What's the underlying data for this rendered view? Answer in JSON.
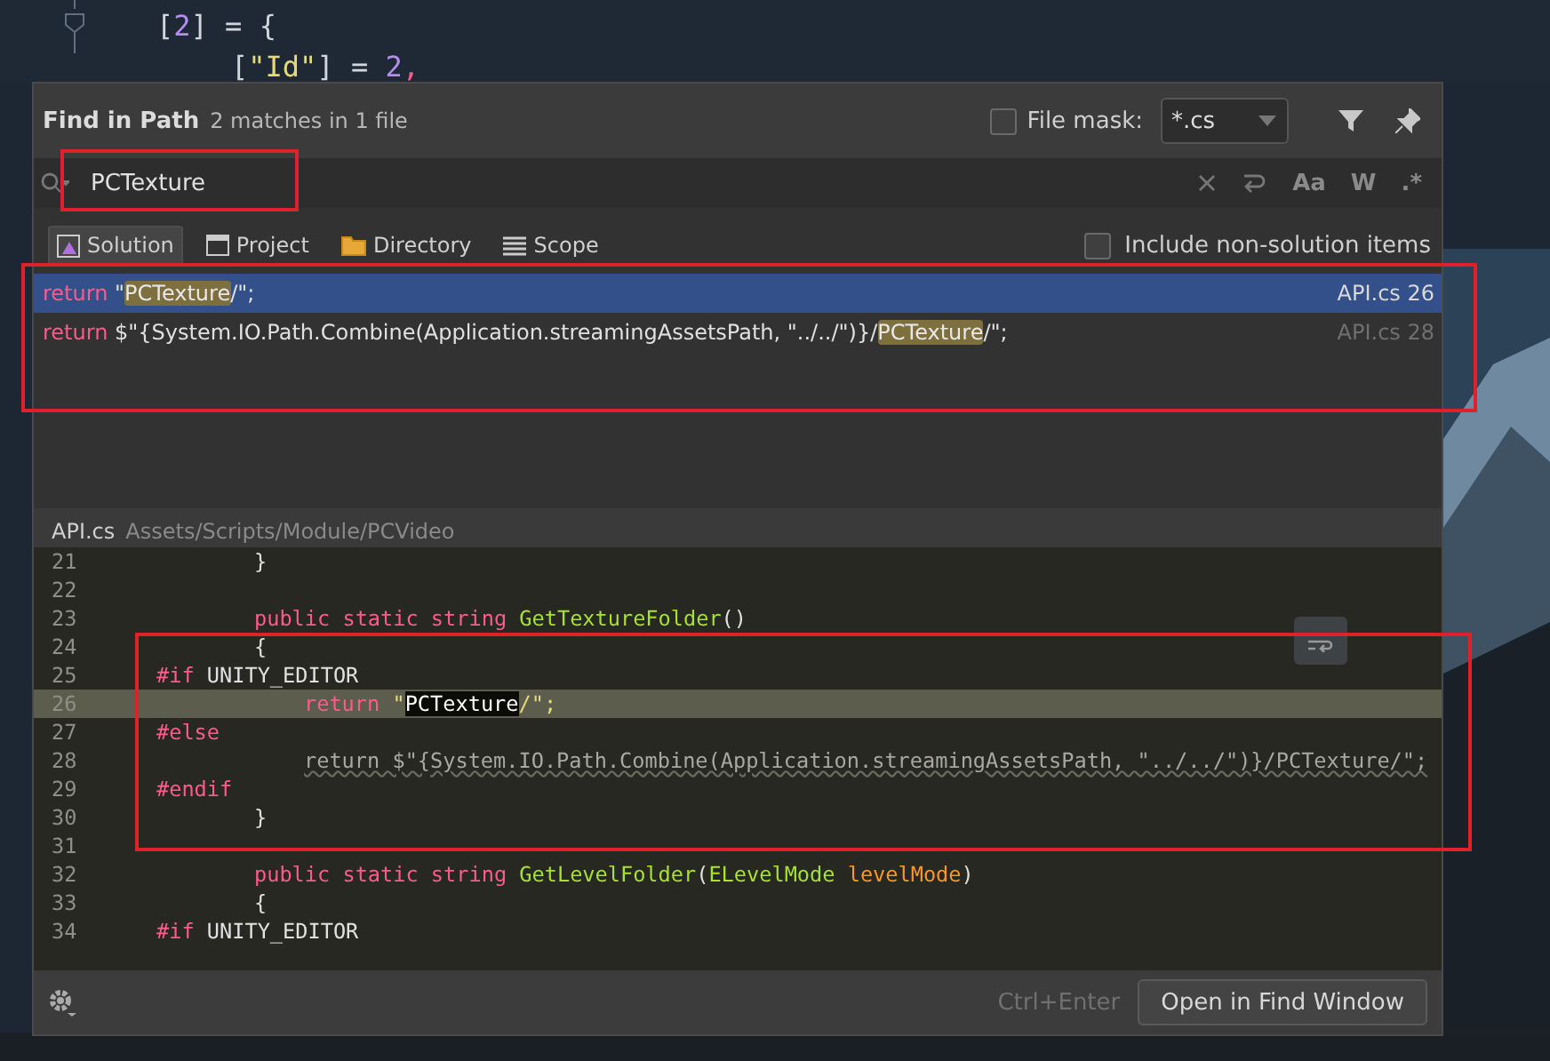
{
  "editor": {
    "lines": [
      {
        "kind": "outer",
        "segments": [
          {
            "kind": "bracket",
            "text": "["
          },
          {
            "kind": "number",
            "text": "2"
          },
          {
            "kind": "bracket",
            "text": "] = {"
          }
        ]
      },
      {
        "kind": "inner",
        "segments": [
          {
            "kind": "bracket",
            "text": "["
          },
          {
            "kind": "string",
            "text": "\"Id\""
          },
          {
            "kind": "bracket",
            "text": "] = "
          },
          {
            "kind": "number",
            "text": "2"
          },
          {
            "kind": "keyword",
            "text": ","
          }
        ]
      }
    ]
  },
  "dialog": {
    "title": "Find in Path",
    "summary": "2 matches in 1 file",
    "file_mask": {
      "label": "File mask:",
      "checked": false,
      "value": "*.cs"
    },
    "search": {
      "value": "PCTexture"
    },
    "search_options": [
      "Aa",
      "W",
      ".*"
    ],
    "scopes": [
      {
        "label": "Solution",
        "selected": true,
        "kind": "solution"
      },
      {
        "label": "Project",
        "selected": false,
        "kind": "project"
      },
      {
        "label": "Directory",
        "selected": false,
        "kind": "directory"
      },
      {
        "label": "Scope",
        "selected": false,
        "kind": "scope"
      }
    ],
    "include_non_solution": {
      "label": "Include non-solution items",
      "checked": false
    },
    "results": [
      {
        "selected": true,
        "location": "API.cs 26",
        "segments": [
          {
            "kind": "keyword",
            "text": "return "
          },
          {
            "kind": "plain",
            "text": "\""
          },
          {
            "kind": "match",
            "text": "PCTexture"
          },
          {
            "kind": "plain",
            "text": "/\";"
          }
        ]
      },
      {
        "selected": false,
        "location": "API.cs 28",
        "segments": [
          {
            "kind": "keyword",
            "text": "return "
          },
          {
            "kind": "plain",
            "text": "$\"{System.IO.Path.Combine(Application.streamingAssetsPath, \"../../\")}/"
          },
          {
            "kind": "match",
            "text": "PCTexture"
          },
          {
            "kind": "plain",
            "text": "/\";"
          }
        ]
      }
    ],
    "preview": {
      "file": "API.cs",
      "path": "Assets/Scripts/Module/PCVideo",
      "lines": [
        {
          "number": "21",
          "kind": "member",
          "current": false,
          "segments": [
            {
              "kind": "plain",
              "text": "}"
            }
          ]
        },
        {
          "number": "22",
          "kind": "blank",
          "current": false
        },
        {
          "number": "23",
          "kind": "member",
          "current": false,
          "segments": [
            {
              "kind": "keyword",
              "text": "public static string "
            },
            {
              "kind": "func",
              "text": "GetTextureFolder"
            },
            {
              "kind": "plain",
              "text": "()"
            }
          ]
        },
        {
          "number": "24",
          "kind": "member",
          "current": false,
          "segments": [
            {
              "kind": "plain",
              "text": "{"
            }
          ]
        },
        {
          "number": "25",
          "kind": "directive",
          "current": false,
          "segments": [
            {
              "kind": "keyword",
              "text": "#if "
            },
            {
              "kind": "plain",
              "text": "UNITY_EDITOR"
            }
          ]
        },
        {
          "number": "26",
          "kind": "statement",
          "current": true,
          "segments": [
            {
              "kind": "keyword",
              "text": "return "
            },
            {
              "kind": "string",
              "text": "\""
            },
            {
              "kind": "match",
              "text": "PCTexture"
            },
            {
              "kind": "string",
              "text": "/\";"
            }
          ]
        },
        {
          "number": "27",
          "kind": "directive",
          "current": false,
          "segments": [
            {
              "kind": "keyword",
              "text": "#else"
            }
          ]
        },
        {
          "number": "28",
          "kind": "statement",
          "current": false,
          "segments": [
            {
              "kind": "inactive",
              "text": "return $\"{System.IO.Path.Combine(Application.streamingAssetsPath, \"../../\")}/PCTexture/\";"
            }
          ]
        },
        {
          "number": "29",
          "kind": "directive",
          "current": false,
          "segments": [
            {
              "kind": "keyword",
              "text": "#endif"
            }
          ]
        },
        {
          "number": "30",
          "kind": "member",
          "current": false,
          "segments": [
            {
              "kind": "plain",
              "text": "}"
            }
          ]
        },
        {
          "number": "31",
          "kind": "blank",
          "current": false
        },
        {
          "number": "32",
          "kind": "member",
          "current": false,
          "segments": [
            {
              "kind": "keyword",
              "text": "public static string "
            },
            {
              "kind": "func",
              "text": "GetLevelFolder"
            },
            {
              "kind": "plain",
              "text": "("
            },
            {
              "kind": "func",
              "text": "ELevelMode "
            },
            {
              "kind": "param",
              "text": "levelMode"
            },
            {
              "kind": "plain",
              "text": ")"
            }
          ]
        },
        {
          "number": "33",
          "kind": "member",
          "current": false,
          "segments": [
            {
              "kind": "plain",
              "text": "{"
            }
          ]
        },
        {
          "number": "34",
          "kind": "directive",
          "current": false,
          "segments": [
            {
              "kind": "keyword",
              "text": "#if "
            },
            {
              "kind": "plain",
              "text": "UNITY_EDITOR"
            }
          ]
        }
      ]
    },
    "shortcut": "Ctrl+Enter",
    "open_button": "Open in Find Window"
  }
}
